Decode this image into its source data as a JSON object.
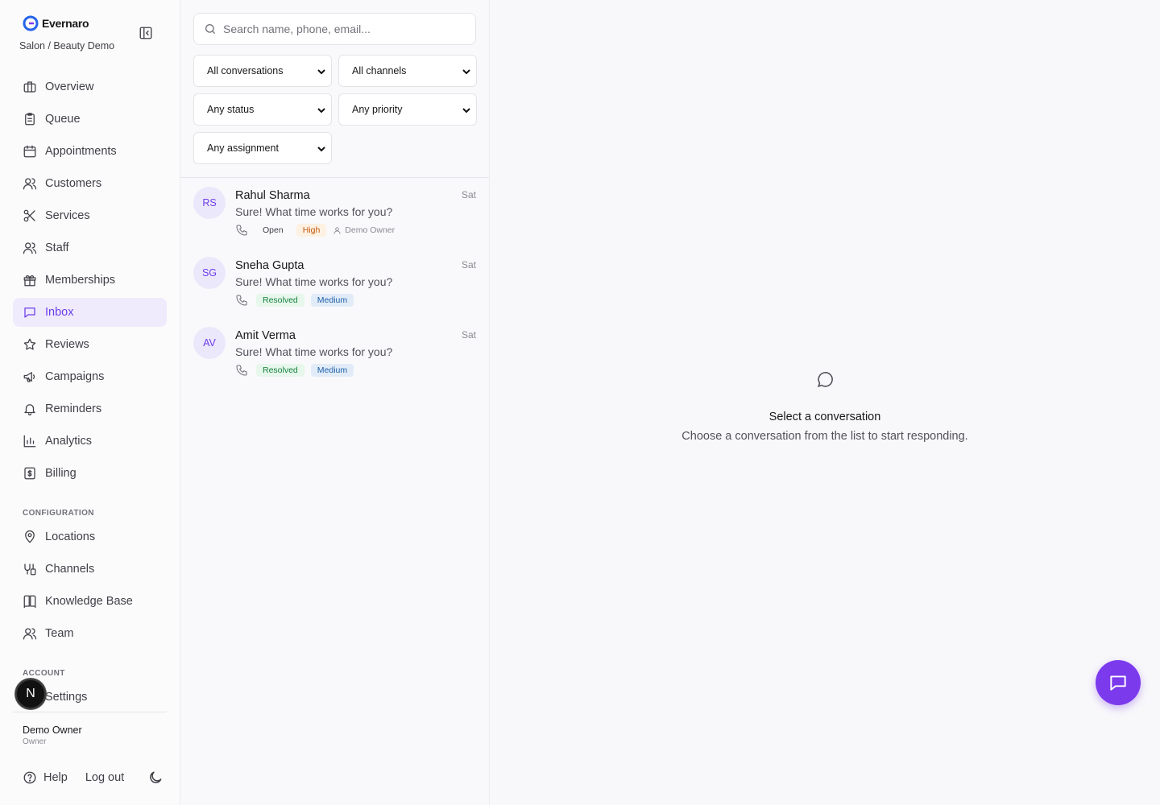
{
  "brand": {
    "name": "Evernaro",
    "org": "Salon / Beauty Demo"
  },
  "nav": {
    "main": [
      {
        "label": "Overview",
        "icon": "briefcase-icon"
      },
      {
        "label": "Queue",
        "icon": "clipboard-icon"
      },
      {
        "label": "Appointments",
        "icon": "calendar-icon"
      },
      {
        "label": "Customers",
        "icon": "users-icon"
      },
      {
        "label": "Services",
        "icon": "scissors-icon"
      },
      {
        "label": "Staff",
        "icon": "users-icon"
      },
      {
        "label": "Memberships",
        "icon": "gift-icon"
      },
      {
        "label": "Inbox",
        "icon": "message-square-icon",
        "active": true
      },
      {
        "label": "Reviews",
        "icon": "star-icon"
      },
      {
        "label": "Campaigns",
        "icon": "megaphone-icon"
      },
      {
        "label": "Reminders",
        "icon": "bell-icon"
      },
      {
        "label": "Analytics",
        "icon": "bar-chart-icon"
      },
      {
        "label": "Billing",
        "icon": "receipt-icon"
      }
    ],
    "config_label": "CONFIGURATION",
    "config": [
      {
        "label": "Locations",
        "icon": "map-pin-icon"
      },
      {
        "label": "Channels",
        "icon": "channels-icon"
      },
      {
        "label": "Knowledge Base",
        "icon": "book-icon"
      },
      {
        "label": "Team",
        "icon": "users-icon"
      }
    ],
    "account_label": "ACCOUNT",
    "account": [
      {
        "label": "Settings",
        "icon": "gear-icon"
      }
    ]
  },
  "user": {
    "name": "Demo Owner",
    "role": "Owner",
    "avatar_letter": "N"
  },
  "footer": {
    "help": "Help",
    "logout": "Log out"
  },
  "search": {
    "placeholder": "Search name, phone, email..."
  },
  "filters": {
    "conversations": "All conversations",
    "channels": "All channels",
    "status": "Any status",
    "priority": "Any priority",
    "assignment": "Any assignment"
  },
  "conversations": [
    {
      "initials": "RS",
      "name": "Rahul Sharma",
      "time": "Sat",
      "message": "Sure! What time works for you?",
      "status": "Open",
      "priority": "High",
      "assignee": "Demo Owner"
    },
    {
      "initials": "SG",
      "name": "Sneha Gupta",
      "time": "Sat",
      "message": "Sure! What time works for you?",
      "status": "Resolved",
      "priority": "Medium"
    },
    {
      "initials": "AV",
      "name": "Amit Verma",
      "time": "Sat",
      "message": "Sure! What time works for you?",
      "status": "Resolved",
      "priority": "Medium"
    }
  ],
  "empty_state": {
    "title": "Select a conversation",
    "subtitle": "Choose a conversation from the list to start responding."
  },
  "colors": {
    "accent": "#7c3aed",
    "active_bg": "#efebfd"
  }
}
